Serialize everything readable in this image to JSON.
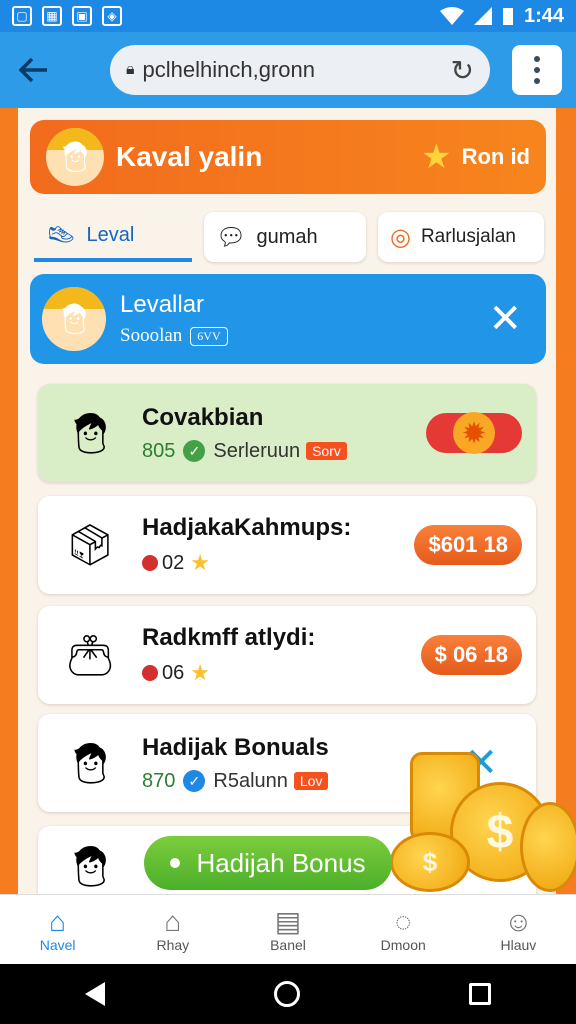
{
  "status_bar": {
    "time": "1:44",
    "icons": [
      "image-icon",
      "grid-icon",
      "photo-icon",
      "bag-icon",
      "wifi-icon",
      "signal-icon",
      "battery-icon"
    ]
  },
  "browser": {
    "url": "pclhelhinch,gronn"
  },
  "header": {
    "title": "Kaval yalin",
    "rank_label": "Ron id"
  },
  "tabs": [
    {
      "label": "Leval",
      "icon": "shoe-icon"
    },
    {
      "label": "gumah",
      "icon": "chat-icon"
    },
    {
      "label": "Rarlusjalan",
      "icon": "target-icon"
    }
  ],
  "notice": {
    "title": "Levallar",
    "subtitle": "Sooolan",
    "chip": "6VV"
  },
  "cards": [
    {
      "name": "Covakbian",
      "value": "805",
      "label": "Serleruun",
      "pill": "Sorv"
    },
    {
      "name": "HadjakaKahmups:",
      "value": "02",
      "button": "$601 18"
    },
    {
      "name": "Radkmff atlydi:",
      "value": "06",
      "button": "$ 06 18"
    },
    {
      "name": "Hadijak Bonuals",
      "value": "870",
      "label": "R5alunn",
      "pill": "Lov"
    }
  ],
  "bonus_button": "Hadijah Bonus",
  "bottom_nav": [
    {
      "label": "Navel",
      "icon": "home-icon"
    },
    {
      "label": "Rhay",
      "icon": "store-icon"
    },
    {
      "label": "Banel",
      "icon": "document-icon"
    },
    {
      "label": "Dmoon",
      "icon": "chat-bubble-icon"
    },
    {
      "label": "Hlauv",
      "icon": "user-icon"
    }
  ],
  "colors": {
    "primary": "#1e88e5",
    "accent": "#f26b1d",
    "success": "#4caf2a"
  }
}
